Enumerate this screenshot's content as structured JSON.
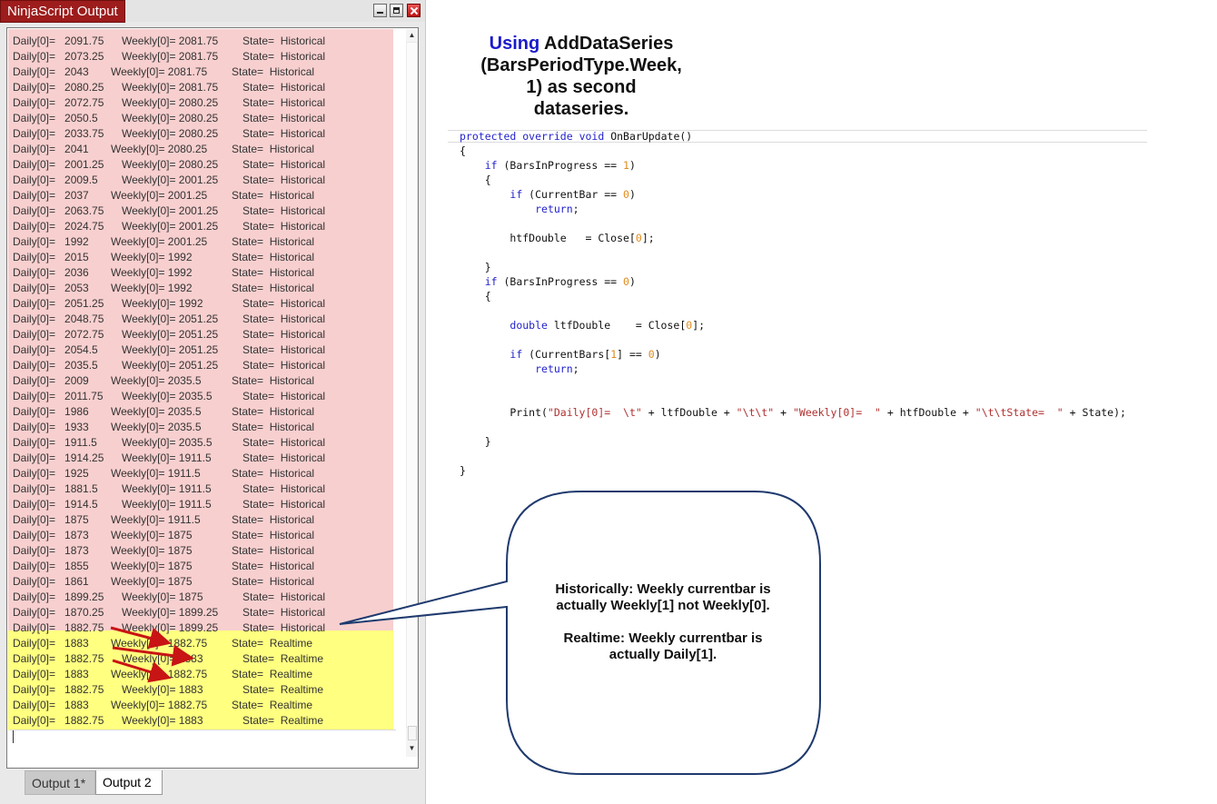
{
  "window": {
    "title": "NinjaScript Output",
    "tabs": [
      "Output 1*",
      "Output 2"
    ],
    "active_tab": "Output 2",
    "colors": {
      "historical_bg": "#f8cfcf",
      "realtime_bg": "#ffff80",
      "title_bg": "#9d1c1c"
    }
  },
  "output_lines": [
    {
      "daily": "Daily[0]=   2091.75",
      "weekly": "Weekly[0]= 2081.75",
      "state": "State=  Historical"
    },
    {
      "daily": "Daily[0]=   2073.25",
      "weekly": "Weekly[0]= 2081.75",
      "state": "State=  Historical"
    },
    {
      "daily": "Daily[0]=   2043",
      "weekly": "Weekly[0]= 2081.75",
      "state": "State=  Historical"
    },
    {
      "daily": "Daily[0]=   2080.25",
      "weekly": "Weekly[0]= 2081.75",
      "state": "State=  Historical"
    },
    {
      "daily": "Daily[0]=   2072.75",
      "weekly": "Weekly[0]= 2080.25",
      "state": "State=  Historical"
    },
    {
      "daily": "Daily[0]=   2050.5",
      "weekly": "Weekly[0]= 2080.25",
      "state": "State=  Historical"
    },
    {
      "daily": "Daily[0]=   2033.75",
      "weekly": "Weekly[0]= 2080.25",
      "state": "State=  Historical"
    },
    {
      "daily": "Daily[0]=   2041",
      "weekly": "Weekly[0]= 2080.25",
      "state": "State=  Historical"
    },
    {
      "daily": "Daily[0]=   2001.25",
      "weekly": "Weekly[0]= 2080.25",
      "state": "State=  Historical"
    },
    {
      "daily": "Daily[0]=   2009.5",
      "weekly": "Weekly[0]= 2001.25",
      "state": "State=  Historical"
    },
    {
      "daily": "Daily[0]=   2037",
      "weekly": "Weekly[0]= 2001.25",
      "state": "State=  Historical"
    },
    {
      "daily": "Daily[0]=   2063.75",
      "weekly": "Weekly[0]= 2001.25",
      "state": "State=  Historical"
    },
    {
      "daily": "Daily[0]=   2024.75",
      "weekly": "Weekly[0]= 2001.25",
      "state": "State=  Historical"
    },
    {
      "daily": "Daily[0]=   1992",
      "weekly": "Weekly[0]= 2001.25",
      "state": "State=  Historical"
    },
    {
      "daily": "Daily[0]=   2015",
      "weekly": "Weekly[0]= 1992",
      "state": "State=  Historical"
    },
    {
      "daily": "Daily[0]=   2036",
      "weekly": "Weekly[0]= 1992",
      "state": "State=  Historical"
    },
    {
      "daily": "Daily[0]=   2053",
      "weekly": "Weekly[0]= 1992",
      "state": "State=  Historical"
    },
    {
      "daily": "Daily[0]=   2051.25",
      "weekly": "Weekly[0]= 1992",
      "state": "State=  Historical"
    },
    {
      "daily": "Daily[0]=   2048.75",
      "weekly": "Weekly[0]= 2051.25",
      "state": "State=  Historical"
    },
    {
      "daily": "Daily[0]=   2072.75",
      "weekly": "Weekly[0]= 2051.25",
      "state": "State=  Historical"
    },
    {
      "daily": "Daily[0]=   2054.5",
      "weekly": "Weekly[0]= 2051.25",
      "state": "State=  Historical"
    },
    {
      "daily": "Daily[0]=   2035.5",
      "weekly": "Weekly[0]= 2051.25",
      "state": "State=  Historical"
    },
    {
      "daily": "Daily[0]=   2009",
      "weekly": "Weekly[0]= 2035.5",
      "state": "State=  Historical"
    },
    {
      "daily": "Daily[0]=   2011.75",
      "weekly": "Weekly[0]= 2035.5",
      "state": "State=  Historical"
    },
    {
      "daily": "Daily[0]=   1986",
      "weekly": "Weekly[0]= 2035.5",
      "state": "State=  Historical"
    },
    {
      "daily": "Daily[0]=   1933",
      "weekly": "Weekly[0]= 2035.5",
      "state": "State=  Historical"
    },
    {
      "daily": "Daily[0]=   1911.5",
      "weekly": "Weekly[0]= 2035.5",
      "state": "State=  Historical"
    },
    {
      "daily": "Daily[0]=   1914.25",
      "weekly": "Weekly[0]= 1911.5",
      "state": "State=  Historical"
    },
    {
      "daily": "Daily[0]=   1925",
      "weekly": "Weekly[0]= 1911.5",
      "state": "State=  Historical"
    },
    {
      "daily": "Daily[0]=   1881.5",
      "weekly": "Weekly[0]= 1911.5",
      "state": "State=  Historical"
    },
    {
      "daily": "Daily[0]=   1914.5",
      "weekly": "Weekly[0]= 1911.5",
      "state": "State=  Historical"
    },
    {
      "daily": "Daily[0]=   1875",
      "weekly": "Weekly[0]= 1911.5",
      "state": "State=  Historical"
    },
    {
      "daily": "Daily[0]=   1873",
      "weekly": "Weekly[0]= 1875",
      "state": "State=  Historical"
    },
    {
      "daily": "Daily[0]=   1873",
      "weekly": "Weekly[0]= 1875",
      "state": "State=  Historical"
    },
    {
      "daily": "Daily[0]=   1855",
      "weekly": "Weekly[0]= 1875",
      "state": "State=  Historical"
    },
    {
      "daily": "Daily[0]=   1861",
      "weekly": "Weekly[0]= 1875",
      "state": "State=  Historical"
    },
    {
      "daily": "Daily[0]=   1899.25",
      "weekly": "Weekly[0]= 1875",
      "state": "State=  Historical"
    },
    {
      "daily": "Daily[0]=   1870.25",
      "weekly": "Weekly[0]= 1899.25",
      "state": "State=  Historical"
    },
    {
      "daily": "Daily[0]=   1882.75",
      "weekly": "Weekly[0]= 1899.25",
      "state": "State=  Historical"
    },
    {
      "daily": "Daily[0]=   1883",
      "weekly": "Weekly[0]= 1882.75",
      "state": "State=  Realtime"
    },
    {
      "daily": "Daily[0]=   1882.75",
      "weekly": "Weekly[0]= 1883",
      "state": "State=  Realtime"
    },
    {
      "daily": "Daily[0]=   1883",
      "weekly": "Weekly[0]= 1882.75",
      "state": "State=  Realtime"
    },
    {
      "daily": "Daily[0]=   1882.75",
      "weekly": "Weekly[0]= 1883",
      "state": "State=  Realtime"
    },
    {
      "daily": "Daily[0]=   1883",
      "weekly": "Weekly[0]= 1882.75",
      "state": "State=  Realtime"
    },
    {
      "daily": "Daily[0]=   1882.75",
      "weekly": "Weekly[0]= 1883",
      "state": "State=  Realtime"
    }
  ],
  "heading": {
    "keyword": "Using",
    "rest1": " AddDataSeries",
    "line2": "(BarsPeriodType.Week,",
    "line3": "1) as second",
    "line4": "dataseries."
  },
  "code_lines": [
    {
      "html": "<span class='k'>protected</span> <span class='k'>override</span> <span class='k'>void</span> OnBarUpdate()"
    },
    {
      "html": "{"
    },
    {
      "html": "    <span class='k'>if</span> (BarsInProgress == <span class='n'>1</span>)"
    },
    {
      "html": "    {"
    },
    {
      "html": "        <span class='k'>if</span> (CurrentBar == <span class='n'>0</span>)"
    },
    {
      "html": "            <span class='k'>return</span>;"
    },
    {
      "html": ""
    },
    {
      "html": "        htfDouble   = Close[<span class='n'>0</span>];"
    },
    {
      "html": ""
    },
    {
      "html": "    }"
    },
    {
      "html": "    <span class='k'>if</span> (BarsInProgress == <span class='n'>0</span>)"
    },
    {
      "html": "    {"
    },
    {
      "html": ""
    },
    {
      "html": "        <span class='k'>double</span> ltfDouble    = Close[<span class='n'>0</span>];"
    },
    {
      "html": ""
    },
    {
      "html": "        <span class='k'>if</span> (CurrentBars[<span class='n'>1</span>] == <span class='n'>0</span>)"
    },
    {
      "html": "            <span class='k'>return</span>;"
    },
    {
      "html": ""
    },
    {
      "html": ""
    },
    {
      "html": "        Print(<span class='s'>\"Daily[0]=  \\t\"</span> + ltfDouble + <span class='s'>\"\\t\\t\"</span> + <span class='s'>\"Weekly[0]=  \"</span> + htfDouble + <span class='s'>\"\\t\\tState=  \"</span> + State);"
    },
    {
      "html": ""
    },
    {
      "html": "    }"
    },
    {
      "html": ""
    },
    {
      "html": "}"
    }
  ],
  "callout": {
    "line1": "Historically: Weekly currentbar is",
    "line2": "actually Weekly[1] not Weekly[0].",
    "line3": "Realtime: Weekly currentbar is",
    "line4": "actually Daily[1]."
  },
  "arrow_color": "#c81414"
}
